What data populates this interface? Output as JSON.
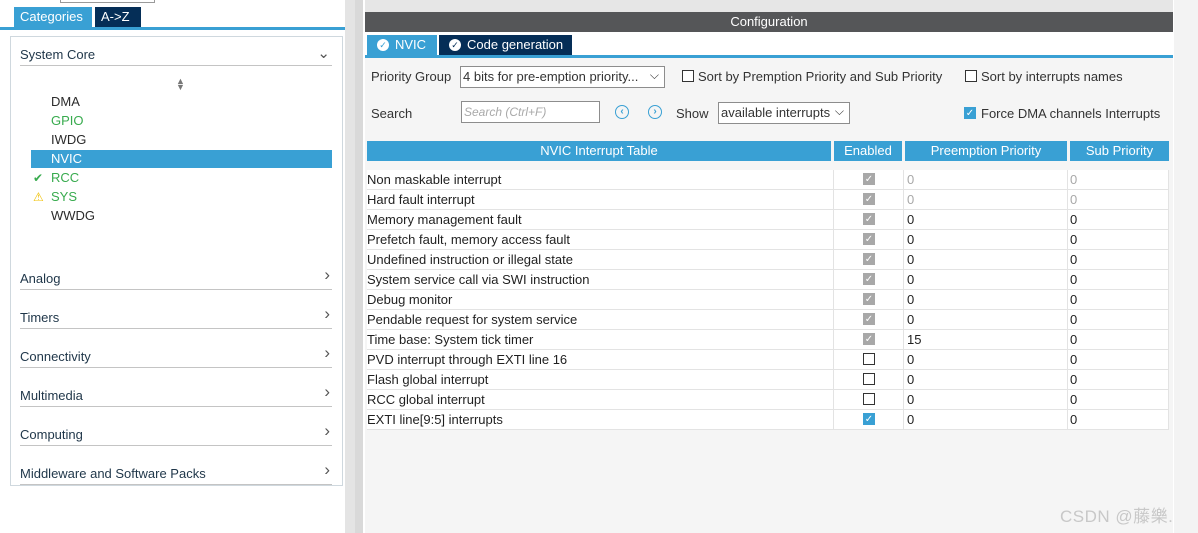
{
  "left": {
    "tabs": {
      "categories": "Categories",
      "az": "A->Z"
    },
    "system_core": {
      "label": "System Core",
      "items": [
        {
          "label": "DMA",
          "state": "normal"
        },
        {
          "label": "GPIO",
          "state": "green"
        },
        {
          "label": "IWDG",
          "state": "normal"
        },
        {
          "label": "NVIC",
          "state": "selected"
        },
        {
          "label": "RCC",
          "state": "green-check"
        },
        {
          "label": "SYS",
          "state": "warning"
        },
        {
          "label": "WWDG",
          "state": "normal"
        }
      ]
    },
    "categories": [
      "Analog",
      "Timers",
      "Connectivity",
      "Multimedia",
      "Computing",
      "Middleware and Software Packs"
    ]
  },
  "right": {
    "title": "Configuration",
    "tabs": {
      "nvic": "NVIC",
      "codegen": "Code generation"
    },
    "controls": {
      "priority_group_label": "Priority Group",
      "priority_group_value": "4 bits for pre-emption priority...",
      "sort_by_preemption": "Sort by Premption Priority and Sub Priority",
      "sort_by_names": "Sort by interrupts names",
      "search_label": "Search",
      "search_placeholder": "Search (Ctrl+F)",
      "show_label": "Show",
      "show_value": "available interrupts",
      "force_dma": "Force DMA channels Interrupts"
    },
    "table": {
      "headers": [
        "NVIC Interrupt Table",
        "Enabled",
        "Preemption Priority",
        "Sub Priority"
      ],
      "rows": [
        {
          "name": "Non maskable interrupt",
          "enabled": "locked",
          "pp": "0",
          "sp": "0",
          "pp_grey": true,
          "sp_grey": true
        },
        {
          "name": "Hard fault interrupt",
          "enabled": "locked",
          "pp": "0",
          "sp": "0",
          "pp_grey": true,
          "sp_grey": true
        },
        {
          "name": "Memory management fault",
          "enabled": "locked",
          "pp": "0",
          "sp": "0"
        },
        {
          "name": "Prefetch fault, memory access fault",
          "enabled": "locked",
          "pp": "0",
          "sp": "0"
        },
        {
          "name": "Undefined instruction or illegal state",
          "enabled": "locked",
          "pp": "0",
          "sp": "0"
        },
        {
          "name": "System service call via SWI instruction",
          "enabled": "locked",
          "pp": "0",
          "sp": "0"
        },
        {
          "name": "Debug monitor",
          "enabled": "locked",
          "pp": "0",
          "sp": "0"
        },
        {
          "name": "Pendable request for system service",
          "enabled": "locked",
          "pp": "0",
          "sp": "0"
        },
        {
          "name": "Time base: System tick timer",
          "enabled": "locked",
          "pp": "15",
          "sp": "0"
        },
        {
          "name": "PVD interrupt through EXTI line 16",
          "enabled": "off",
          "pp": "0",
          "sp": "0"
        },
        {
          "name": "Flash global interrupt",
          "enabled": "off",
          "pp": "0",
          "sp": "0"
        },
        {
          "name": "RCC global interrupt",
          "enabled": "off",
          "pp": "0",
          "sp": "0"
        },
        {
          "name": "EXTI line[9:5] interrupts",
          "enabled": "on",
          "pp": "0",
          "sp": "0"
        }
      ]
    }
  },
  "watermark": "CSDN @藤樂.",
  "colors": {
    "accent": "#39a0d4",
    "dark_tab": "#052e57",
    "header_bar": "#555658",
    "ok_green": "#38ab4e",
    "warn_yellow": "#f0c000"
  }
}
